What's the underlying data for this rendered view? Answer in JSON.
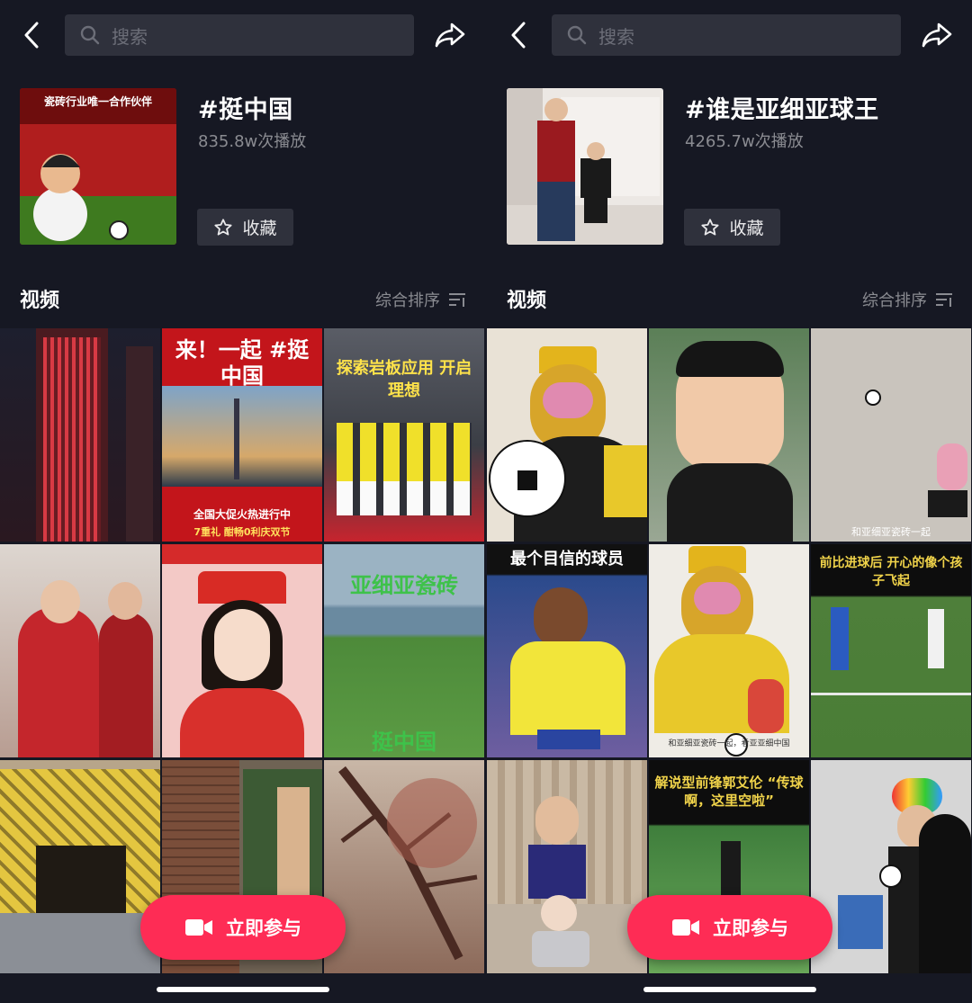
{
  "screens": [
    {
      "search_placeholder": "搜索",
      "hashtag": "#挺中国",
      "plays": "835.8w次播放",
      "collect_label": "收藏",
      "section": "视频",
      "sort_label": "综合排序",
      "join_label": "立即参与",
      "cover_banner": "瓷砖行业唯一合作伙伴",
      "tiles": [
        {
          "caption": ""
        },
        {
          "caption": "来！一起 #挺中国",
          "subcaption": "全国大促火热进行中",
          "footer": "7重礼 酣畅0利庆双节"
        },
        {
          "caption": "探索岩板应用 开启理想"
        },
        {
          "caption": ""
        },
        {
          "caption": ""
        },
        {
          "caption": "亚细亚瓷砖",
          "footer": "挺中国"
        },
        {
          "caption": ""
        },
        {
          "caption": ""
        },
        {
          "caption": ""
        }
      ]
    },
    {
      "search_placeholder": "搜索",
      "hashtag": "#谁是亚细亚球王",
      "plays": "4265.7w次播放",
      "collect_label": "收藏",
      "section": "视频",
      "sort_label": "综合排序",
      "join_label": "立即参与",
      "tiles": [
        {
          "caption": ""
        },
        {
          "caption": ""
        },
        {
          "caption": "",
          "footer": "和亚细亚瓷砖一起"
        },
        {
          "caption": "最个目信的球员"
        },
        {
          "caption": "",
          "footer": "和亚细亚瓷砖一起，看亚亚细中国"
        },
        {
          "caption": "前比进球后 开心的像个孩子飞起"
        },
        {
          "caption": ""
        },
        {
          "caption": "解说型前锋郭艾伦 “传球啊，这里空啦”"
        },
        {
          "caption": ""
        }
      ]
    }
  ],
  "colors": {
    "accent": "#fe2c55",
    "bg": "#161823",
    "surface": "#2f313c"
  }
}
